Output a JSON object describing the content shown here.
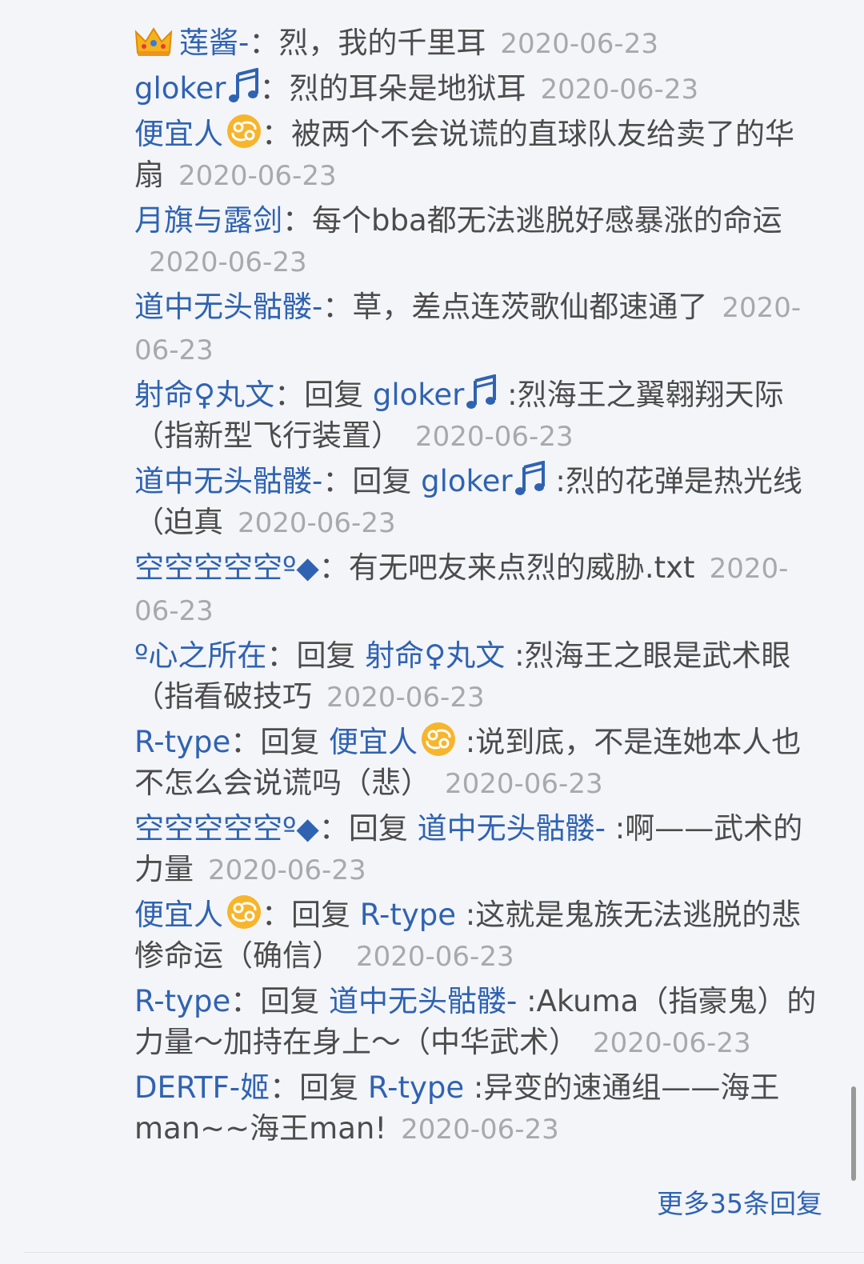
{
  "colors": {
    "username": "#2f63b2",
    "text": "#4c4c4c",
    "date": "#a8a8ad",
    "background": "#f4f5f9"
  },
  "sep": "：",
  "reply_word": "回复",
  "replies": [
    {
      "user": "莲酱-",
      "badge": "crown-icon",
      "content": "烈，我的千里耳",
      "date": "2020-06-23"
    },
    {
      "user": "gloker",
      "badge": "music-note-icon",
      "content": "烈的耳朵是地狱耳",
      "date": "2020-06-23"
    },
    {
      "user": "便宜人",
      "badge": "cancer-zodiac-icon",
      "content": "被两个不会说谎的直球队友给卖了的华扇",
      "date": "2020-06-23"
    },
    {
      "user": "月旗与露剑",
      "content": "每个bba都无法逃脱好感暴涨的命运",
      "date": "2020-06-23"
    },
    {
      "user": "道中无头骷髅-",
      "content": "草，差点连茨歌仙都速通了",
      "date": "2020-06-23"
    },
    {
      "user": "射命♀丸文",
      "reply_to": "gloker",
      "reply_to_badge": "music-note-icon",
      "content": ":烈海王之翼翱翔天际（指新型飞行装置）",
      "date": "2020-06-23"
    },
    {
      "user": "道中无头骷髅-",
      "reply_to": "gloker",
      "reply_to_badge": "music-note-icon",
      "content": ":烈的花弹是热光线（迫真",
      "date": "2020-06-23"
    },
    {
      "user": "空空空空空º◆",
      "content": "有无吧友来点烈的威胁.txt",
      "date": "2020-06-23"
    },
    {
      "user": "º心之所在",
      "reply_to": "射命♀丸文",
      "content": ":烈海王之眼是武术眼（指看破技巧",
      "date": "2020-06-23"
    },
    {
      "user": "R-type",
      "reply_to": "便宜人",
      "reply_to_badge": "cancer-zodiac-icon",
      "content": ":说到底，不是连她本人也不怎么会说谎吗（悲）",
      "date": "2020-06-23"
    },
    {
      "user": "空空空空空º◆",
      "reply_to": "道中无头骷髅-",
      "content": ":啊——武术的力量",
      "date": "2020-06-23"
    },
    {
      "user": "便宜人",
      "badge": "cancer-zodiac-icon",
      "reply_to": "R-type",
      "content": ":这就是鬼族无法逃脱的悲惨命运（确信）",
      "date": "2020-06-23"
    },
    {
      "user": "R-type",
      "reply_to": "道中无头骷髅-",
      "content": ":Akuma（指豪鬼）的力量～加持在身上～（中华武术）",
      "date": "2020-06-23"
    },
    {
      "user": "DERTF-姬",
      "reply_to": "R-type",
      "content": ":异变的速通组——海王man~~海王man!",
      "date": "2020-06-23"
    }
  ],
  "more_replies": "更多35条回复"
}
